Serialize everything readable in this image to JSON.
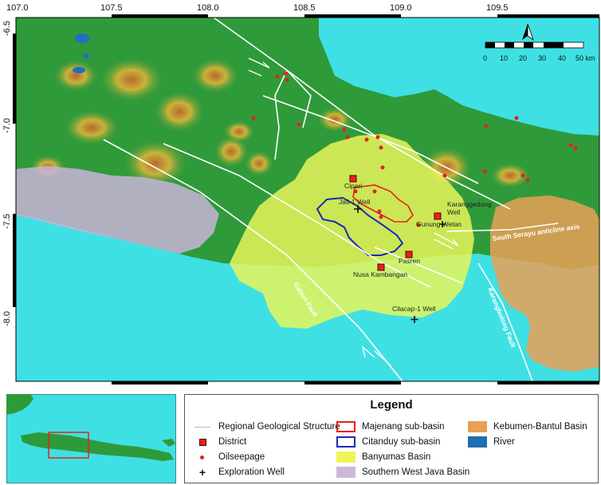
{
  "map": {
    "x_ticks": [
      "107.0",
      "107.5",
      "108.0",
      "108.5",
      "109.0",
      "109.5"
    ],
    "y_ticks": [
      "-6.5",
      "-7.0",
      "-7.5",
      "-8.0"
    ],
    "scalebar_ticks": [
      "0",
      "10",
      "20",
      "30",
      "40",
      "50 km"
    ],
    "north_arrow": "north-arrow-icon",
    "places": {
      "ciparl": "Cipari",
      "jati": "Jati-1 Well",
      "karang": "Karanggedang",
      "karang2": "Well",
      "gunung": "Gunung Wetan",
      "pasren": "Pasren",
      "nusa": "Nusa Kambangan",
      "cilacap": "Cilacap-1 Well"
    },
    "faults": {
      "gabon": "Gabon Fault",
      "karangbolong": "Karangbolong Fault",
      "serayu": "South Serayu anticline axis"
    },
    "colors": {
      "sea": "#3fe0e3",
      "land": "#2f9a3a",
      "banyumas": "#e6f55a",
      "sw_java": "#c8b4d8",
      "kebumen": "#e8a057",
      "majenang": "#e3231c",
      "citanduy": "#1b2bb5",
      "oilseep": "#e3231c"
    }
  },
  "legend": {
    "title": "Legend",
    "items": {
      "structure": "Regional Geological Structure",
      "district": "District",
      "oilseep": "Oilseepage",
      "well": "Exploration Well",
      "majenang": "Majenang sub-basin",
      "citanduy": "Citanduy sub-basin",
      "banyumas": "Banyumas Basin",
      "swjava": "Southern West Java Basin",
      "kebumen": "Kebumen-Bantul Basin",
      "river": "River"
    }
  }
}
